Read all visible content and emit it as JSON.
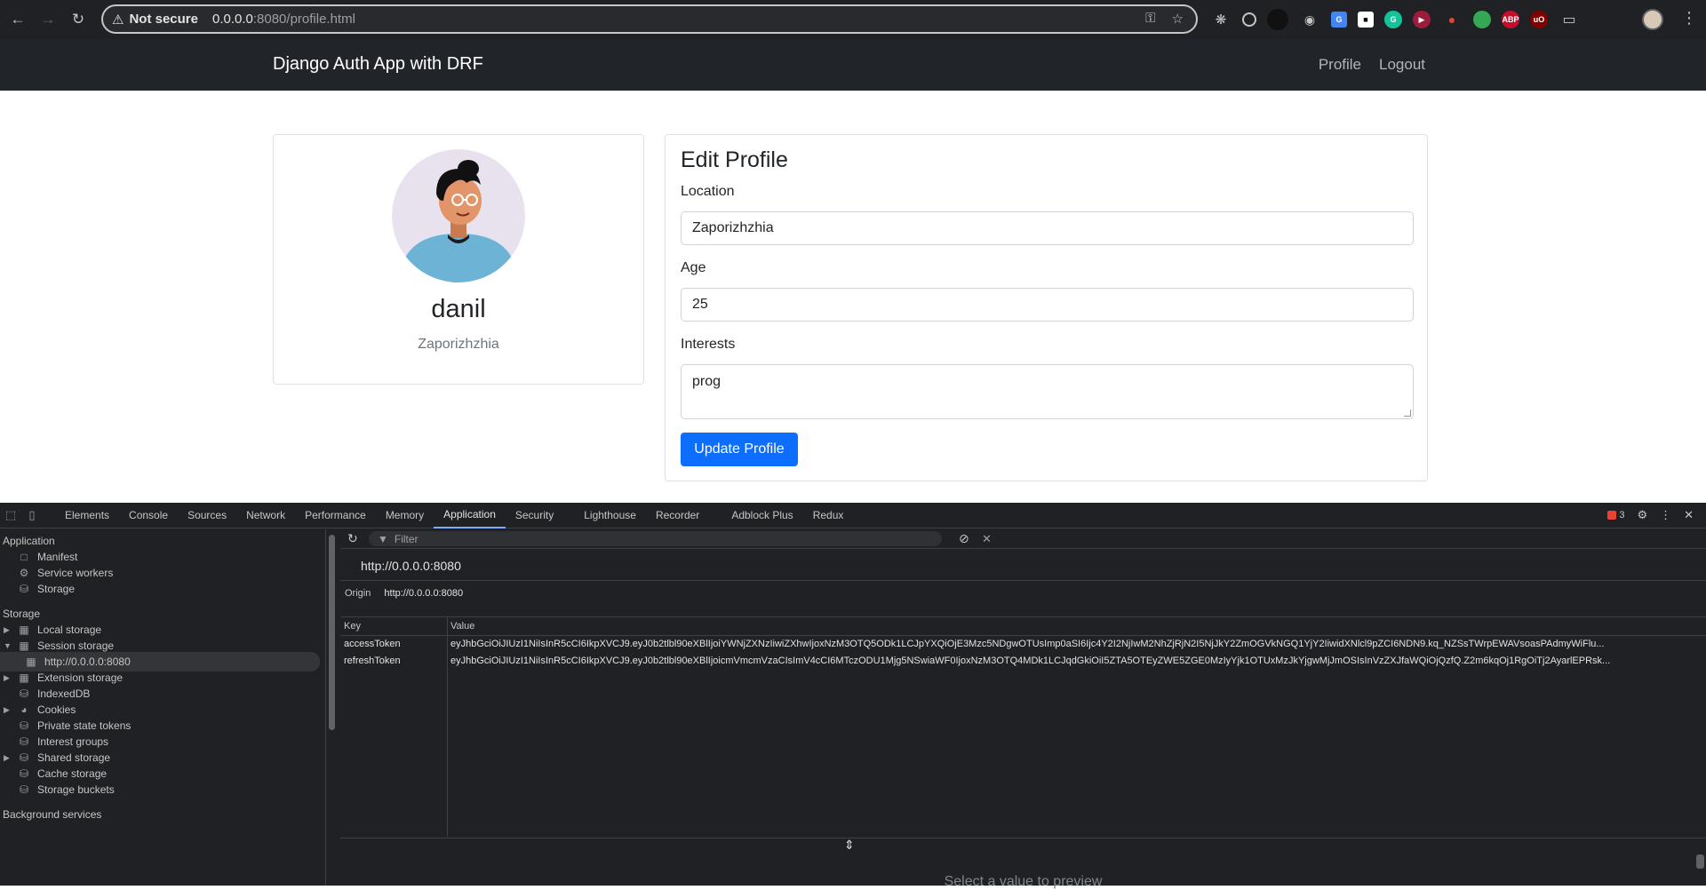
{
  "browser": {
    "security": "Not secure",
    "url_host": "0.0.0.0",
    "url_path": ":8080/profile.html"
  },
  "app": {
    "brand": "Django Auth App with DRF",
    "nav": [
      "Profile",
      "Logout"
    ]
  },
  "profile": {
    "name": "danil",
    "location": "Zaporizhzhia"
  },
  "edit": {
    "title": "Edit Profile",
    "location_label": "Location",
    "location_value": "Zaporizhzhia",
    "age_label": "Age",
    "age_value": "25",
    "interests_label": "Interests",
    "interests_value": "prog",
    "submit": "Update Profile"
  },
  "devtools": {
    "tabs": [
      "Elements",
      "Console",
      "Sources",
      "Network",
      "Performance",
      "Memory",
      "Application",
      "Security",
      "Lighthouse",
      "Recorder",
      "Adblock Plus",
      "Redux"
    ],
    "active_tab": "Application",
    "error_count": "3",
    "sidebar": {
      "section_application": "Application",
      "app_items": [
        "Manifest",
        "Service workers",
        "Storage"
      ],
      "section_storage": "Storage",
      "storage_items": [
        "Local storage",
        "Session storage",
        "http://0.0.0.0:8080",
        "Extension storage",
        "IndexedDB",
        "Cookies",
        "Private state tokens",
        "Interest groups",
        "Shared storage",
        "Cache storage",
        "Storage buckets"
      ],
      "section_background": "Background services"
    },
    "filter_placeholder": "Filter",
    "origin_heading": "http://0.0.0.0:8080",
    "origin_label": "Origin",
    "origin_value": "http://0.0.0.0:8080",
    "table": {
      "headers": [
        "Key",
        "Value"
      ],
      "rows": [
        {
          "key": "accessToken",
          "value": "eyJhbGciOiJIUzI1NiIsInR5cCI6IkpXVCJ9.eyJ0b2tlbl90eXBlIjoiYWNjZXNzIiwiZXhwIjoxNzM3OTQ5ODk1LCJpYXQiOjE3Mzc5NDgwOTUsImp0aSI6Ijc4Y2I2NjIwM2NhZjRjN2I5NjJkY2ZmOGVkNGQ1YjY2IiwidXNlcl9pZCI6NDN9.kq_NZSsTWrpEWAVsoasPAdmyWiFlu..."
        },
        {
          "key": "refreshToken",
          "value": "eyJhbGciOiJIUzI1NiIsInR5cCI6IkpXVCJ9.eyJ0b2tlbl90eXBlIjoicmVmcmVzaCIsImV4cCI6MTczODU1Mjg5NSwiaWF0IjoxNzM3OTQ4MDk1LCJqdGkiOiI5ZTA5OTEyZWE5ZGE0MzIyYjk1OTUxMzJkYjgwMjJmOSIsInVzZXJfaWQiOjQzfQ.Z2m6kqOj1RgOiTj2AyarlEPRsk..."
        }
      ]
    },
    "preview_text": "Select a value to preview"
  }
}
